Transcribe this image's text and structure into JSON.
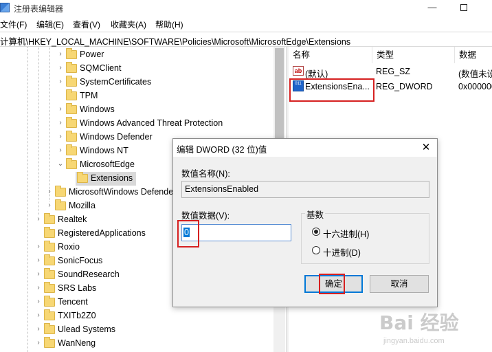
{
  "window": {
    "title": "注册表编辑器",
    "minimize_glyph": "—",
    "maximize_glyph": ""
  },
  "menu": [
    {
      "label": "文件(F)"
    },
    {
      "label": "编辑(E)"
    },
    {
      "label": "查看(V)"
    },
    {
      "label": "收藏夹(A)"
    },
    {
      "label": "帮助(H)"
    }
  ],
  "address": "计算机\\HKEY_LOCAL_MACHINE\\SOFTWARE\\Policies\\Microsoft\\MicrosoftEdge\\Extensions",
  "tree": {
    "items": [
      {
        "label": "Power",
        "expander": "›"
      },
      {
        "label": "SQMClient",
        "expander": "›"
      },
      {
        "label": "SystemCertificates",
        "expander": "›"
      },
      {
        "label": "TPM",
        "expander": ""
      },
      {
        "label": "Windows",
        "expander": "›"
      },
      {
        "label": "Windows Advanced Threat Protection",
        "expander": "›"
      },
      {
        "label": "Windows Defender",
        "expander": "›"
      },
      {
        "label": "Windows NT",
        "expander": "›"
      },
      {
        "label": "MicrosoftEdge",
        "expander": "⌄"
      },
      {
        "label": "Extensions",
        "expander": ""
      },
      {
        "label": "MicrosoftWindows Defender",
        "expander": "›"
      },
      {
        "label": "Mozilla",
        "expander": "›"
      },
      {
        "label": "Realtek",
        "expander": "›"
      },
      {
        "label": "RegisteredApplications",
        "expander": ""
      },
      {
        "label": "Roxio",
        "expander": "›"
      },
      {
        "label": "SonicFocus",
        "expander": "›"
      },
      {
        "label": "SoundResearch",
        "expander": "›"
      },
      {
        "label": "SRS Labs",
        "expander": "›"
      },
      {
        "label": "Tencent",
        "expander": "›"
      },
      {
        "label": "TXITb2Z0",
        "expander": "›"
      },
      {
        "label": "Ulead Systems",
        "expander": "›"
      },
      {
        "label": "WanNeng",
        "expander": "›"
      }
    ]
  },
  "values": {
    "headers": {
      "name": "名称",
      "type": "类型",
      "data": "数据"
    },
    "rows": [
      {
        "icon": "ab",
        "name": "(默认)",
        "type": "REG_SZ",
        "data": "(数值未设"
      },
      {
        "icon": "011",
        "name": "ExtensionsEna...",
        "type": "REG_DWORD",
        "data": "0x000000"
      }
    ]
  },
  "dialog": {
    "title": "编辑 DWORD (32 位)值",
    "close_glyph": "✕",
    "value_name_label": "数值名称(N):",
    "value_name": "ExtensionsEnabled",
    "value_data_label": "数值数据(V):",
    "value_data": "0",
    "base_label": "基数",
    "hex_label": "十六进制(H)",
    "dec_label": "十进制(D)",
    "base_selected": "hex",
    "ok_label": "确定",
    "cancel_label": "取消"
  },
  "watermark": {
    "brand": "Bai 经验",
    "url": "jingyan.baidu.com"
  },
  "colors": {
    "highlight_box": "#d62020",
    "selection": "#0078d7",
    "folder": "#f7d774"
  }
}
